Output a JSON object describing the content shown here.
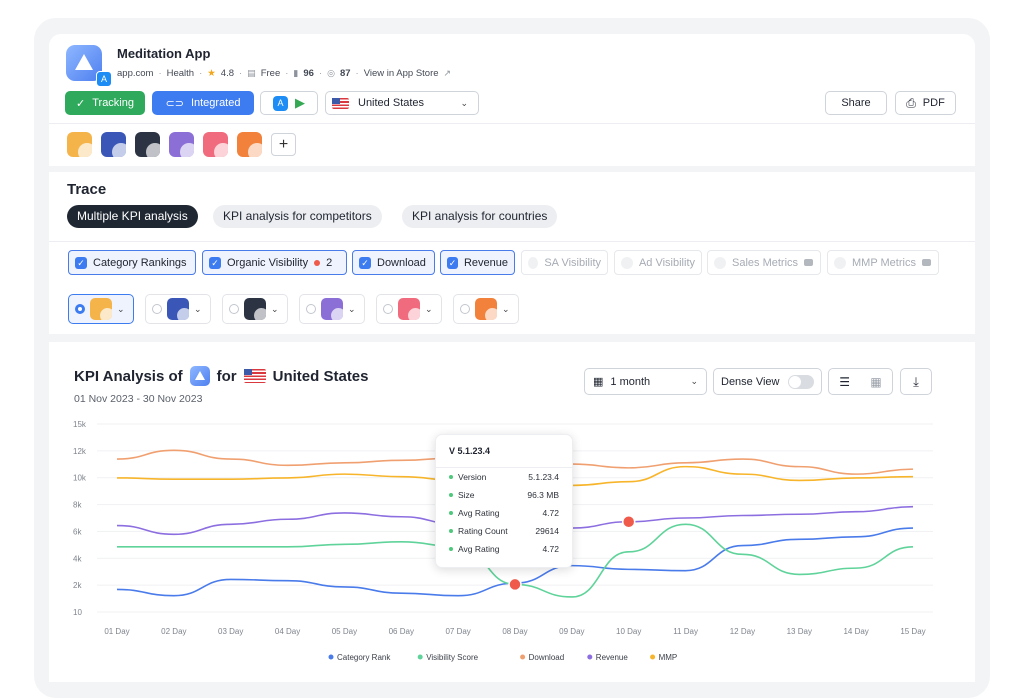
{
  "app": {
    "name": "Meditation App",
    "developer": "app.com",
    "category": "Health",
    "rating": "4.8",
    "price": "Free",
    "rank": "96",
    "score": "87",
    "store_link": "View in App Store"
  },
  "header": {
    "tracking_label": "Tracking",
    "integrated_label": "Integrated",
    "country": "United States",
    "share_label": "Share",
    "pdf_label": "PDF"
  },
  "competitor_colors": [
    "#f5b44a",
    "#3a57b8",
    "#2c3444",
    "#8b6fd6",
    "#f06b7e",
    "#f2813b"
  ],
  "trace": {
    "title": "Trace",
    "tabs": [
      {
        "label": "Multiple KPI analysis",
        "active": true
      },
      {
        "label": "KPI analysis for competitors",
        "active": false
      },
      {
        "label": "KPI analysis for countries",
        "active": false
      }
    ],
    "metrics": [
      {
        "label": "Category Rankings",
        "checked": true
      },
      {
        "label": "Organic Visibility",
        "checked": true,
        "badge": "2"
      },
      {
        "label": "Download",
        "checked": true
      },
      {
        "label": "Revenue",
        "checked": true
      },
      {
        "label": "SA Visibility",
        "checked": false
      },
      {
        "label": "Ad Visibility",
        "checked": false
      },
      {
        "label": "Sales Metrics",
        "checked": false
      },
      {
        "label": "MMP Metrics",
        "checked": false
      }
    ]
  },
  "kpi": {
    "title_prefix": "KPI Analysis of",
    "title_for": "for",
    "country": "United States",
    "date_range": "01 Nov 2023 - 30 Nov 2023",
    "period": "1 month",
    "dense_view_label": "Dense View"
  },
  "tooltip": {
    "title": "V 5.1.23.4",
    "rows": [
      {
        "label": "Version",
        "value": "5.1.23.4"
      },
      {
        "label": "Size",
        "value": "96.3 MB"
      },
      {
        "label": "Avg Rating",
        "value": "4.72"
      },
      {
        "label": "Rating Count",
        "value": "29614"
      },
      {
        "label": "Avg Rating",
        "value": "4.72"
      }
    ]
  },
  "chart_data": {
    "type": "line",
    "x": [
      "01 Day",
      "02 Day",
      "03 Day",
      "04 Day",
      "05 Day",
      "06 Day",
      "07 Day",
      "08 Day",
      "09 Day",
      "10 Day",
      "11 Day",
      "12 Day",
      "13 Day",
      "14 Day",
      "15 Day"
    ],
    "yticks": [
      "15k",
      "12k",
      "10k",
      "8k",
      "6k",
      "4k",
      "2k",
      "10"
    ],
    "series": [
      {
        "name": "Category Rank",
        "color": "#4a7bea",
        "values": [
          1.8,
          1.3,
          2.6,
          2.5,
          2.0,
          1.5,
          1.3,
          2.3,
          3.7,
          3.4,
          3.3,
          5.3,
          5.8,
          6.0,
          6.7
        ]
      },
      {
        "name": "Visibility Score",
        "color": "#5fd39a",
        "values": [
          5.2,
          5.2,
          5.2,
          5.2,
          5.4,
          5.6,
          5.2,
          2.2,
          1.2,
          4.8,
          7.0,
          4.6,
          3.0,
          3.5,
          5.2
        ]
      },
      {
        "name": "Download",
        "color": "#f0a070",
        "values": [
          12.2,
          12.9,
          12.2,
          11.7,
          11.9,
          12.1,
          12.3,
          12.0,
          11.8,
          11.5,
          11.9,
          12.2,
          11.6,
          11.0,
          11.4
        ]
      },
      {
        "name": "Revenue",
        "color": "#8c6ee0",
        "values": [
          6.9,
          6.2,
          7.0,
          7.4,
          7.9,
          7.6,
          7.0,
          6.4,
          6.7,
          7.2,
          7.5,
          7.7,
          7.8,
          8.0,
          8.4
        ]
      },
      {
        "name": "MMP",
        "color": "#f7b52b",
        "values": [
          10.7,
          10.6,
          10.6,
          10.7,
          11.0,
          10.8,
          10.5,
          10.0,
          10.1,
          10.4,
          11.6,
          11.0,
          10.5,
          10.7,
          10.8
        ]
      }
    ],
    "ylim": [
      0,
      15
    ]
  }
}
